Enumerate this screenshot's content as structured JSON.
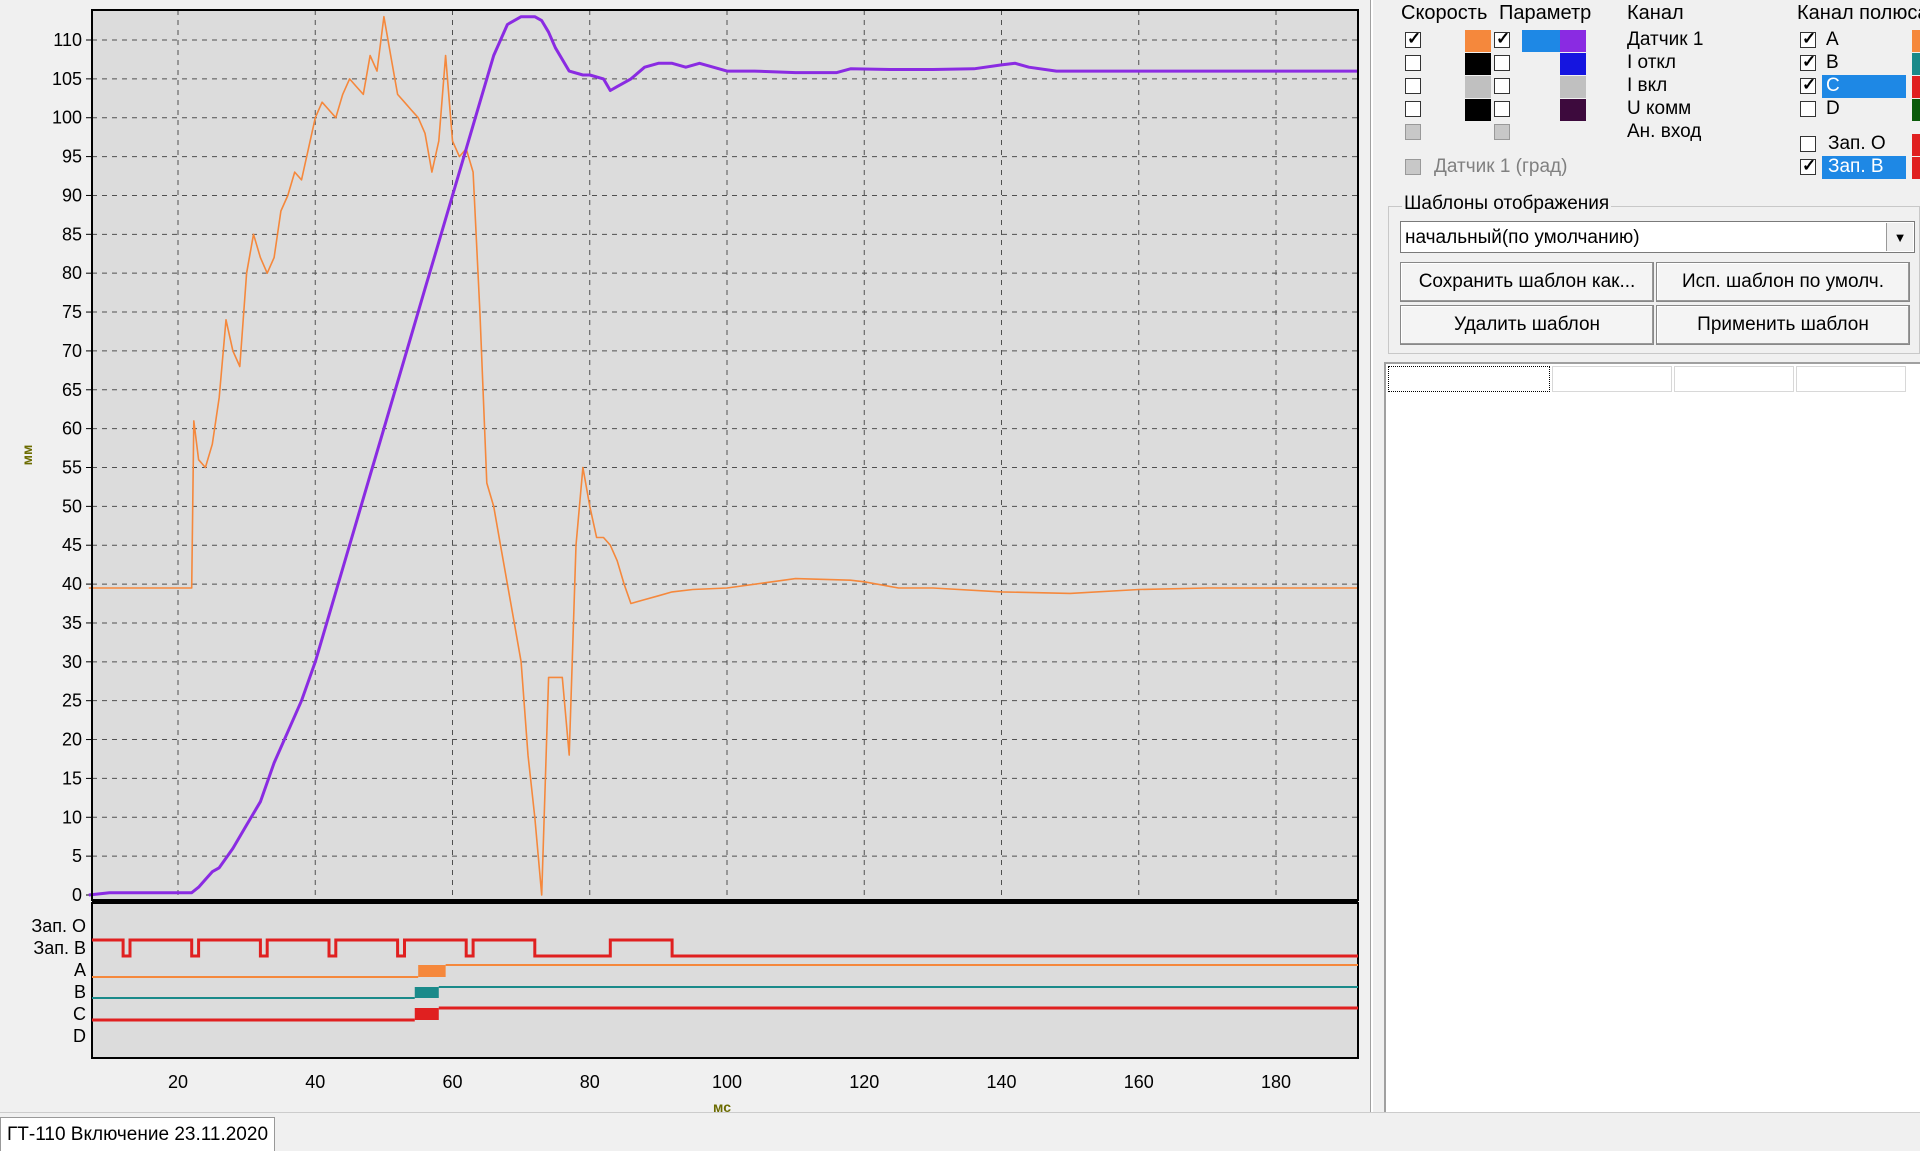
{
  "plot": {
    "y_axis_label": "мм",
    "x_axis_label": "мс",
    "y_ticks": [
      "0",
      "5",
      "10",
      "15",
      "20",
      "25",
      "30",
      "35",
      "40",
      "45",
      "50",
      "55",
      "60",
      "65",
      "70",
      "75",
      "80",
      "85",
      "90",
      "95",
      "100",
      "105",
      "110"
    ],
    "x_ticks": [
      "20",
      "40",
      "60",
      "80",
      "100",
      "120",
      "140",
      "160",
      "180"
    ],
    "digital_labels": [
      "Зап. О",
      "Зап. В",
      "A",
      "B",
      "C",
      "D"
    ]
  },
  "chart_data": {
    "type": "line",
    "xlabel": "мс",
    "ylabel": "мм",
    "xlim": [
      7,
      192
    ],
    "ylim": [
      0,
      113
    ],
    "x_ticks": [
      20,
      40,
      60,
      80,
      100,
      120,
      140,
      160,
      180
    ],
    "y_ticks": [
      0,
      5,
      10,
      15,
      20,
      25,
      30,
      35,
      40,
      45,
      50,
      55,
      60,
      65,
      70,
      75,
      80,
      85,
      90,
      95,
      100,
      105,
      110
    ],
    "grid": true,
    "series": [
      {
        "name": "Датчик 1",
        "color": "#8a2be2",
        "x": [
          7,
          10,
          15,
          20,
          22,
          23,
          24,
          25,
          26,
          28,
          30,
          32,
          34,
          36,
          38,
          40,
          42,
          44,
          46,
          48,
          50,
          52,
          54,
          56,
          58,
          60,
          62,
          64,
          66,
          68,
          70,
          72,
          73,
          74,
          75,
          77,
          79,
          80,
          82,
          83,
          84,
          86,
          88,
          90,
          92,
          94,
          96,
          98,
          100,
          104,
          110,
          116,
          118,
          124,
          130,
          136,
          140,
          142,
          144,
          148,
          160,
          170,
          180,
          185,
          192
        ],
        "y": [
          0,
          0.3,
          0.3,
          0.3,
          0.3,
          1,
          2,
          3,
          3.5,
          6,
          9,
          12,
          17,
          21,
          25,
          30,
          36,
          42,
          48,
          54,
          60,
          66,
          72,
          78,
          84,
          90,
          96,
          102,
          108,
          112,
          113,
          113,
          112.5,
          111,
          109,
          106,
          105.5,
          105.5,
          105,
          103.5,
          104,
          105,
          106.5,
          107,
          107,
          106.5,
          107,
          106.5,
          106,
          106,
          105.8,
          105.8,
          106.3,
          106.2,
          106.2,
          106.3,
          106.8,
          107,
          106.5,
          106,
          106,
          106,
          106,
          106,
          106
        ]
      },
      {
        "name": "Скорость",
        "color": "#f5883c",
        "x": [
          7,
          10,
          15,
          20,
          21,
          22,
          22.3,
          23,
          24,
          25,
          26,
          27,
          28,
          29,
          30,
          31,
          32,
          33,
          34,
          35,
          36,
          37,
          38,
          39,
          40,
          41,
          42,
          43,
          44,
          45,
          46,
          47,
          48,
          49,
          50,
          51,
          52,
          53,
          54,
          55,
          56,
          57,
          58,
          59,
          60,
          61,
          62,
          63,
          64,
          65,
          66,
          67,
          68,
          69,
          70,
          71,
          72,
          73,
          74,
          75,
          76,
          77,
          78,
          79,
          80,
          81,
          82,
          83,
          84,
          85,
          86,
          88,
          90,
          92,
          95,
          100,
          110,
          118,
          120,
          125,
          130,
          140,
          150,
          160,
          170,
          180,
          192
        ],
        "y": [
          39.5,
          39.5,
          39.5,
          39.5,
          39.5,
          39.5,
          61,
          56,
          55,
          58,
          64,
          74,
          70,
          68,
          80,
          85,
          82,
          80,
          82,
          88,
          90,
          93,
          92,
          96,
          100,
          102,
          101,
          100,
          103,
          105,
          104,
          103,
          108,
          106,
          113,
          108,
          103,
          102,
          101,
          100,
          98,
          93,
          97,
          108,
          97,
          95,
          96,
          93,
          75,
          53,
          50,
          45,
          40,
          35,
          30,
          18,
          10,
          0,
          28,
          28,
          28,
          18,
          45,
          55,
          50,
          46,
          46,
          45,
          43,
          40,
          37.5,
          38,
          38.5,
          39,
          39.3,
          39.5,
          40.7,
          40.5,
          40.3,
          39.5,
          39.5,
          39,
          38.8,
          39.3,
          39.5,
          39.5,
          39.5
        ]
      }
    ]
  },
  "digital": {
    "zap_b_color": "#e02020",
    "a_color": "#f5883c",
    "b_color": "#1a8a8a",
    "c_color": "#e02020",
    "d_color": "#e02020"
  },
  "panel": {
    "col_speed": "Скорость",
    "col_param": "Параметр",
    "col_channel": "Канал",
    "col_pole": "Канал полюса",
    "channels": [
      {
        "name": "Датчик 1",
        "speed_checked": true,
        "param_checked": true,
        "speed_color": "#f5883c",
        "param_color": "#8a2be2",
        "sel_color": "#1e88e5"
      },
      {
        "name": "I откл",
        "speed_checked": false,
        "param_checked": false,
        "speed_color": "#000000",
        "param_color": "#1515e0",
        "sel_color": ""
      },
      {
        "name": "I вкл",
        "speed_checked": false,
        "param_checked": false,
        "speed_color": "#c0c0c0",
        "param_color": "#c0c0c0",
        "sel_color": ""
      },
      {
        "name": "U комм",
        "speed_checked": false,
        "param_checked": false,
        "speed_color": "#000000",
        "param_color": "#3d0a3d",
        "sel_color": ""
      },
      {
        "name": "Ан. вход",
        "speed_checked": false,
        "param_checked": false,
        "speed_color": "",
        "param_color": "",
        "sel_color": ""
      }
    ],
    "sensor_deg": "Датчик 1 (град)",
    "poles": [
      {
        "name": "A",
        "checked": true,
        "color": "#f5883c",
        "selected": false
      },
      {
        "name": "B",
        "checked": true,
        "color": "#1a8a8a",
        "selected": false
      },
      {
        "name": "C",
        "checked": true,
        "color": "#e02020",
        "selected": true
      },
      {
        "name": "D",
        "checked": false,
        "color": "#0a5a0a",
        "selected": false
      }
    ],
    "zap": [
      {
        "name": "Зап. О",
        "checked": false,
        "color": "#e02020",
        "selected": false
      },
      {
        "name": "Зап. В",
        "checked": true,
        "color": "#e02020",
        "selected": true
      }
    ],
    "templates_title": "Шаблоны отображения",
    "template_value": "начальный(по умолчанию)",
    "btn_save": "Сохранить шаблон как...",
    "btn_default": "Исп. шаблон по умолч.",
    "btn_delete": "Удалить шаблон",
    "btn_apply": "Применить шаблон"
  },
  "bottom_tab": "ГТ-110 Включение 23.11.2020"
}
